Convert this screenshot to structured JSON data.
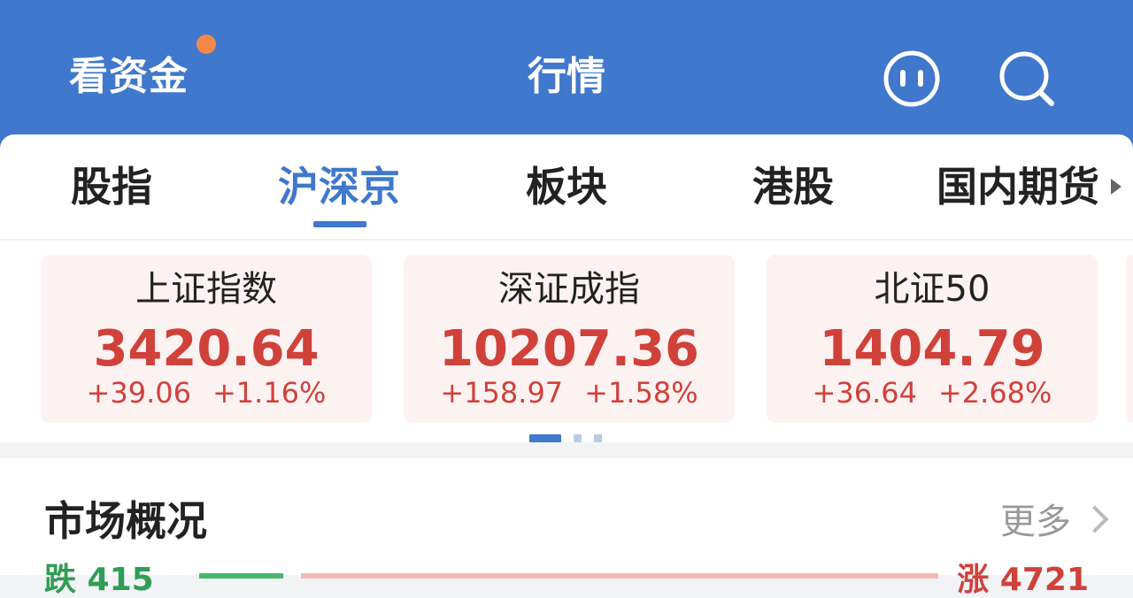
{
  "header": {
    "left_label": "看资金",
    "title": "行情",
    "icons": [
      "chat-robot-icon",
      "search-icon"
    ]
  },
  "tabs": [
    {
      "label": "股指",
      "active": false
    },
    {
      "label": "沪深京",
      "active": true
    },
    {
      "label": "板块",
      "active": false
    },
    {
      "label": "港股",
      "active": false
    },
    {
      "label": "国内期货",
      "active": false
    }
  ],
  "indices": [
    {
      "name": "上证指数",
      "value": "3420.64",
      "change": "+39.06",
      "change_pct": "+1.16%"
    },
    {
      "name": "深证成指",
      "value": "10207.36",
      "change": "+158.97",
      "change_pct": "+1.58%"
    },
    {
      "name": "北证50",
      "value": "1404.79",
      "change": "+36.64",
      "change_pct": "+2.68%"
    }
  ],
  "carousel": {
    "page_count": 3,
    "active_page": 0
  },
  "market_overview": {
    "title": "市场概况",
    "more_label": "更多",
    "fall_label": "跌 415",
    "rise_label": "涨 4721"
  },
  "colors": {
    "header_bg": "#3f78cc",
    "accent": "#3f78cc",
    "up_red": "#d0413a",
    "down_green": "#2f9e54",
    "notification_dot": "#f2884a"
  }
}
